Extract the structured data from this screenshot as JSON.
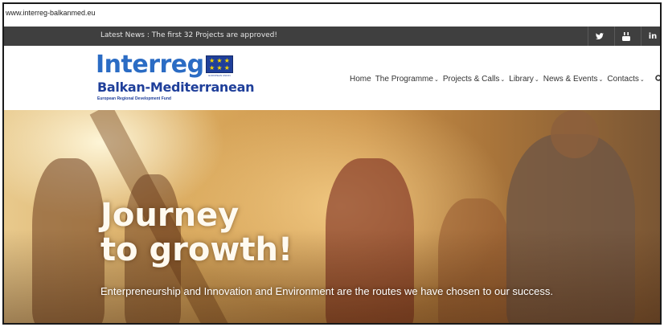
{
  "browser": {
    "url": "www.interreg-balkanmed.eu"
  },
  "top_bar": {
    "news": "Latest News : The first 32 Projects are approved!",
    "social_icons": [
      {
        "name": "twitter-icon",
        "glyph": "🐦"
      },
      {
        "name": "youtube-icon",
        "glyph": "▶"
      },
      {
        "name": "linkedin-icon",
        "glyph": "in"
      }
    ]
  },
  "logo": {
    "word": "Interreg",
    "subtitle": "Balkan-Mediterranean",
    "fund": "European Regional Development Fund",
    "flag_caption": "EUROPEAN UNION",
    "brand_color": "#2b6cc4"
  },
  "nav": {
    "items": [
      {
        "label": "Home",
        "dropdown": false
      },
      {
        "label": "The Programme",
        "dropdown": true
      },
      {
        "label": "Projects & Calls",
        "dropdown": true
      },
      {
        "label": "Library",
        "dropdown": true
      },
      {
        "label": "News & Events",
        "dropdown": true
      },
      {
        "label": "Contacts",
        "dropdown": true
      }
    ],
    "search_icon": "search-icon"
  },
  "hero": {
    "title_line1": "Journey",
    "title_line2": "to growth!",
    "subtitle": "Enterpreneurship and Innovation and Environment are the routes we have chosen to our success."
  }
}
